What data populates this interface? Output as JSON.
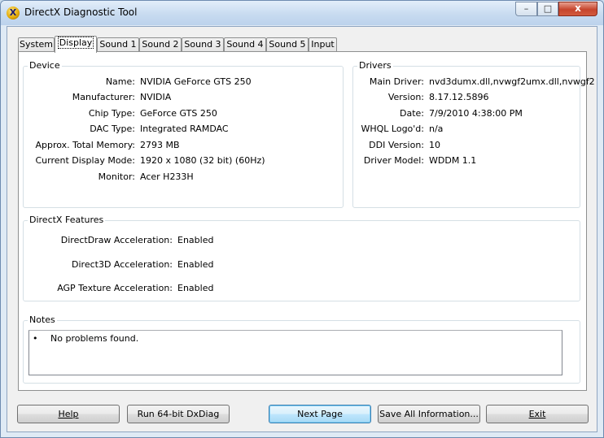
{
  "window": {
    "title": "DirectX Diagnostic Tool",
    "controls": {
      "minimize": "–",
      "maximize": "□",
      "close": "x"
    }
  },
  "tabs": [
    {
      "label": "System"
    },
    {
      "label": "Display"
    },
    {
      "label": "Sound 1"
    },
    {
      "label": "Sound 2"
    },
    {
      "label": "Sound 3"
    },
    {
      "label": "Sound 4"
    },
    {
      "label": "Sound 5"
    },
    {
      "label": "Input"
    }
  ],
  "device": {
    "heading": "Device",
    "rows": [
      {
        "label": "Name:",
        "value": "NVIDIA GeForce GTS 250"
      },
      {
        "label": "Manufacturer:",
        "value": "NVIDIA"
      },
      {
        "label": "Chip Type:",
        "value": "GeForce GTS 250"
      },
      {
        "label": "DAC Type:",
        "value": "Integrated RAMDAC"
      },
      {
        "label": "Approx. Total Memory:",
        "value": "2793 MB"
      },
      {
        "label": "Current Display Mode:",
        "value": "1920 x 1080 (32 bit) (60Hz)"
      },
      {
        "label": "Monitor:",
        "value": "Acer H233H"
      }
    ]
  },
  "drivers": {
    "heading": "Drivers",
    "rows": [
      {
        "label": "Main Driver:",
        "value": "nvd3dumx.dll,nvwgf2umx.dll,nvwgf2"
      },
      {
        "label": "Version:",
        "value": "8.17.12.5896"
      },
      {
        "label": "Date:",
        "value": "7/9/2010 4:38:00 PM"
      },
      {
        "label": "WHQL Logo'd:",
        "value": "n/a"
      },
      {
        "label": "DDI Version:",
        "value": "10"
      },
      {
        "label": "Driver Model:",
        "value": "WDDM 1.1"
      }
    ]
  },
  "features": {
    "heading": "DirectX Features",
    "rows": [
      {
        "label": "DirectDraw Acceleration:",
        "value": "Enabled"
      },
      {
        "label": "Direct3D Acceleration:",
        "value": "Enabled"
      },
      {
        "label": "AGP Texture Acceleration:",
        "value": "Enabled"
      }
    ]
  },
  "notes": {
    "heading": "Notes",
    "bullet": "•",
    "text": "No problems found."
  },
  "buttons": {
    "help": "Help",
    "run64": "Run 64-bit DxDiag",
    "next": "Next Page",
    "save": "Save All Information...",
    "exit": "Exit"
  },
  "icons": {
    "app": "directx-icon"
  }
}
